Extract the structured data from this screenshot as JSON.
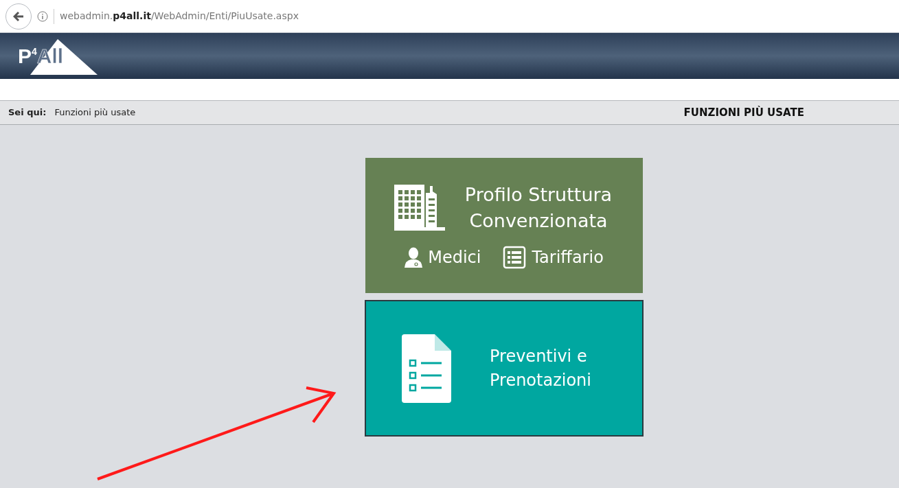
{
  "browser": {
    "url": "webadmin.**p4all.it**/WebAdmin/Enti/PiuUsate.aspx"
  },
  "logo": {
    "letter": "P",
    "superscript": "4",
    "rest": "All"
  },
  "breadcrumb": {
    "label": "Sei qui:",
    "current": "Funzioni più usate"
  },
  "page_title": "FUNZIONI PIÙ USATE",
  "tiles": [
    {
      "kind": "profile",
      "title": "Profilo Struttura Convenzionata",
      "selected": false,
      "color": "#668154",
      "links": [
        {
          "label": "Medici",
          "kind": "doctor"
        },
        {
          "label": "Tariffario",
          "kind": "list"
        }
      ]
    },
    {
      "kind": "simple",
      "title": "Preventivi e Prenotazioni",
      "selected": true,
      "color": "#00a7a0"
    }
  ]
}
